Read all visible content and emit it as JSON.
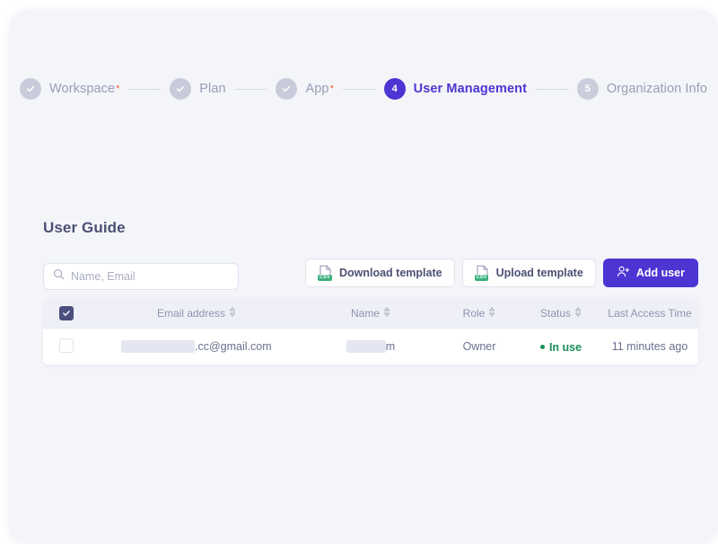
{
  "colors": {
    "accent": "#4c35d3",
    "muted": "#9a9db6",
    "required_star": "#ff5b3a",
    "status_green": "#18905c",
    "csv_green": "#3aaf7c",
    "card_bg": "#f4f5f9",
    "table_header_bg": "#eff0f7"
  },
  "stepper": {
    "steps": [
      {
        "num": "1",
        "label": "Workspace",
        "state": "done",
        "required": true,
        "icon": "check-icon"
      },
      {
        "num": "2",
        "label": "Plan",
        "state": "done",
        "required": false,
        "icon": "check-icon"
      },
      {
        "num": "3",
        "label": "App",
        "state": "done",
        "required": true,
        "icon": "check-icon"
      },
      {
        "num": "4",
        "label": "User Management",
        "state": "active",
        "required": false,
        "icon": ""
      },
      {
        "num": "5",
        "label": "Organization Info",
        "state": "todo",
        "required": false,
        "icon": ""
      }
    ],
    "required_marker": "*"
  },
  "section": {
    "title": "User Guide"
  },
  "search": {
    "placeholder": "Name, Email",
    "value": "",
    "icon": "search-icon"
  },
  "toolbar": {
    "download_template_label": "Download template",
    "download_template_icon": "csv-file-icon",
    "upload_template_label": "Upload template",
    "upload_template_icon": "csv-file-icon",
    "add_user_label": "Add user",
    "add_user_icon": "user-plus-icon",
    "csv_badge_text": "CSV"
  },
  "table": {
    "select_all_checked": true,
    "columns": [
      {
        "key": "check",
        "label": "",
        "sortable": false
      },
      {
        "key": "email",
        "label": "Email address",
        "sortable": true
      },
      {
        "key": "name",
        "label": "Name",
        "sortable": true
      },
      {
        "key": "role",
        "label": "Role",
        "sortable": true
      },
      {
        "key": "status",
        "label": "Status",
        "sortable": true
      },
      {
        "key": "time",
        "label": "Last Access Time",
        "sortable": false
      }
    ],
    "rows": [
      {
        "checked": false,
        "email_redacted": true,
        "email_visible": ".cc@gmail.com",
        "name_redacted": true,
        "name_visible": "m",
        "role": "Owner",
        "status": "In use",
        "last_access": "11 minutes ago"
      }
    ]
  }
}
